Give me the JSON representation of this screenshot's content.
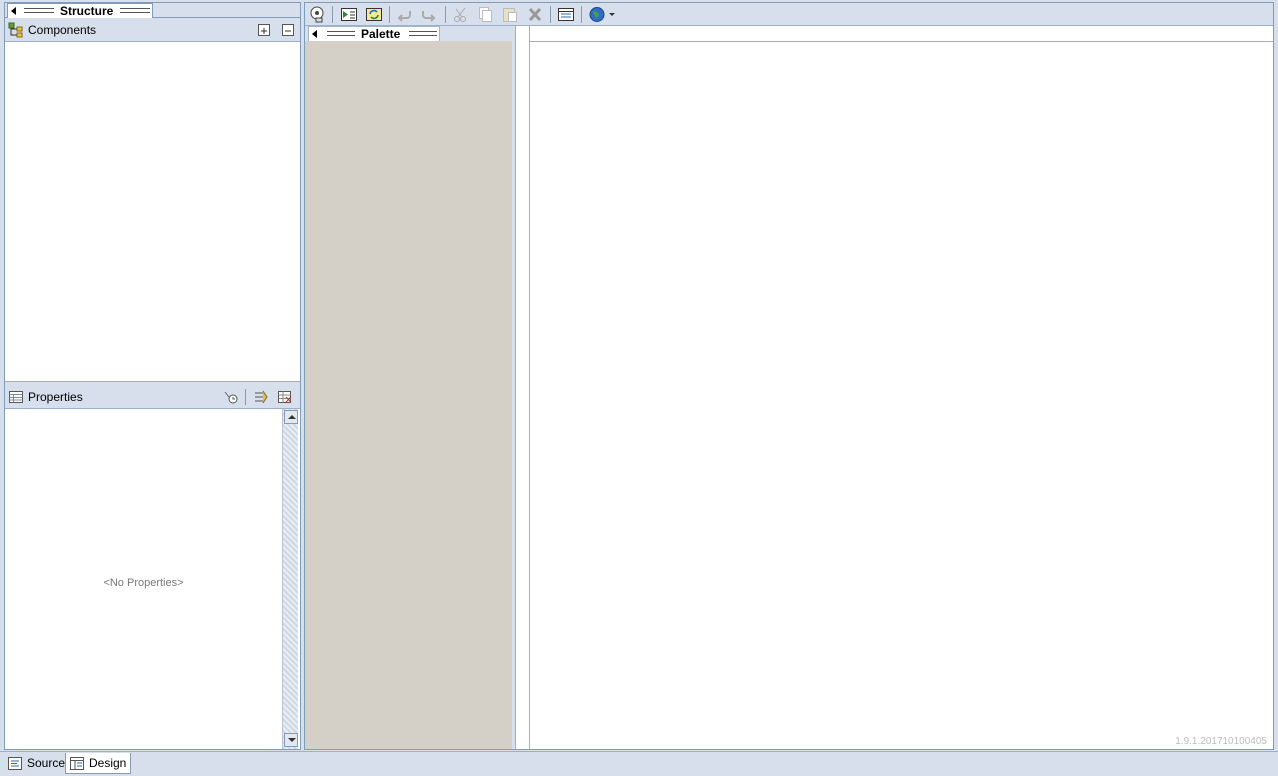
{
  "structure": {
    "title": "Structure",
    "components_label": "Components",
    "expand_icon": "expand-all-icon",
    "collapse_icon": "collapse-all-icon"
  },
  "properties": {
    "label": "Properties",
    "empty_text": "<No Properties>"
  },
  "palette": {
    "title": "Palette"
  },
  "toolbar": {
    "icons": [
      "preview-icon",
      "run-icon",
      "refresh-icon",
      "undo-icon",
      "redo-icon",
      "cut-icon",
      "copy-icon",
      "paste-icon",
      "delete-icon",
      "properties-icon",
      "globe-icon"
    ]
  },
  "canvas": {
    "version": "1.9.1.201710100405"
  },
  "bottom_tabs": {
    "source_label": "Source",
    "design_label": "Design"
  },
  "colors": {
    "chrome": "#d6dfeb",
    "palette_bg": "#d4d0c8",
    "border": "#7f9db9"
  }
}
